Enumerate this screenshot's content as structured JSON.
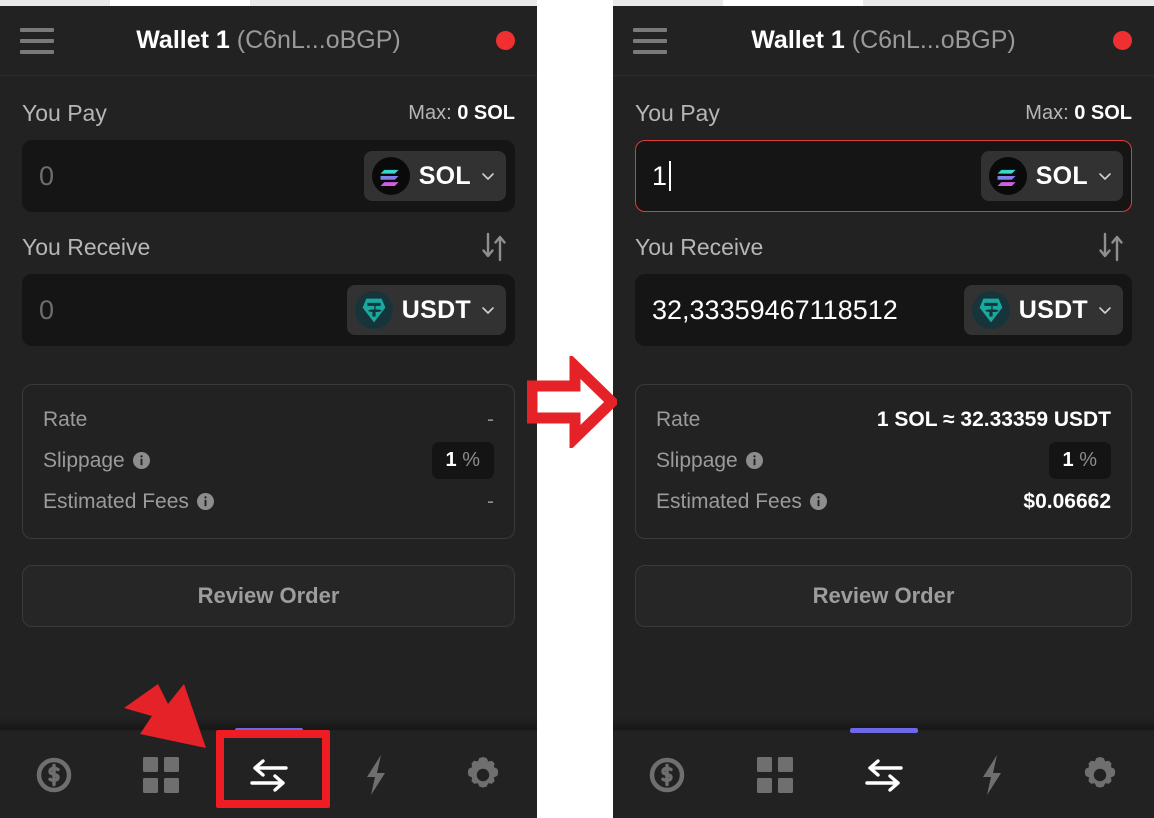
{
  "meta": {
    "app": "Solana Wallet Swap Extension",
    "panels": [
      "before",
      "after"
    ]
  },
  "header": {
    "menu_icon": "hamburger-icon",
    "wallet_name": "Wallet 1",
    "wallet_address": "(C6nL...oBGP)",
    "status_dot_color": "#f03030",
    "status_icon": "status-dot-icon"
  },
  "colors": {
    "page_bg": "#222222",
    "input_bg": "#151515",
    "pill_bg": "#323232",
    "accent_active_tab": "#6e67e6",
    "annotation_red": "#ee1d23",
    "focus_border": "#e03a3a",
    "sol_teal": "#19e0b4",
    "sol_purple": "#b45cf0",
    "usdt_teal": "#26a17b"
  },
  "left_panel": {
    "you_pay": {
      "label": "You Pay",
      "max_label": "Max:",
      "max_value": "0 SOL",
      "amount_value": "",
      "amount_placeholder": "0",
      "focused": false,
      "token": {
        "symbol": "SOL",
        "icon": "sol-token-icon",
        "chevron": "chevron-down-icon"
      }
    },
    "you_receive": {
      "label": "You Receive",
      "swap_icon": "swap-vertical-arrows-icon",
      "amount_value": "",
      "amount_placeholder": "0",
      "token": {
        "symbol": "USDT",
        "icon": "usdt-token-icon",
        "chevron": "chevron-down-icon"
      }
    },
    "details": {
      "rate_label": "Rate",
      "rate_value": "-",
      "slippage_label": "Slippage",
      "slippage_info_icon": "info-icon",
      "slippage_value": "1",
      "slippage_unit": "%",
      "fees_label": "Estimated Fees",
      "fees_info_icon": "info-icon",
      "fees_value": "-"
    },
    "review_button": "Review Order"
  },
  "right_panel": {
    "you_pay": {
      "label": "You Pay",
      "max_label": "Max:",
      "max_value": "0 SOL",
      "amount_value": "1",
      "amount_placeholder": "0",
      "focused": true,
      "token": {
        "symbol": "SOL",
        "icon": "sol-token-icon",
        "chevron": "chevron-down-icon"
      }
    },
    "you_receive": {
      "label": "You Receive",
      "swap_icon": "swap-vertical-arrows-icon",
      "amount_value": "32,33359467118512",
      "amount_placeholder": "0",
      "token": {
        "symbol": "USDT",
        "icon": "usdt-token-icon",
        "chevron": "chevron-down-icon"
      }
    },
    "details": {
      "rate_label": "Rate",
      "rate_value": "1 SOL ≈ 32.33359 USDT",
      "slippage_label": "Slippage",
      "slippage_info_icon": "info-icon",
      "slippage_value": "1",
      "slippage_unit": "%",
      "fees_label": "Estimated Fees",
      "fees_info_icon": "info-icon",
      "fees_value": "$0.06662"
    },
    "review_button": "Review Order"
  },
  "tabbar": {
    "active_index": 2,
    "tabs": [
      {
        "name": "tab-tokens",
        "icon": "dollar-circle-icon"
      },
      {
        "name": "tab-apps",
        "icon": "grid-squares-icon"
      },
      {
        "name": "tab-swap",
        "icon": "swap-horizontal-arrows-icon"
      },
      {
        "name": "tab-activity",
        "icon": "lightning-bolt-icon"
      },
      {
        "name": "tab-settings",
        "icon": "gear-icon"
      }
    ]
  },
  "annotations": {
    "transition_arrow": "red-right-arrow-outline",
    "pointer_arrow": "red-pointer-arrow",
    "highlight_box": "red-highlight-rectangle"
  }
}
